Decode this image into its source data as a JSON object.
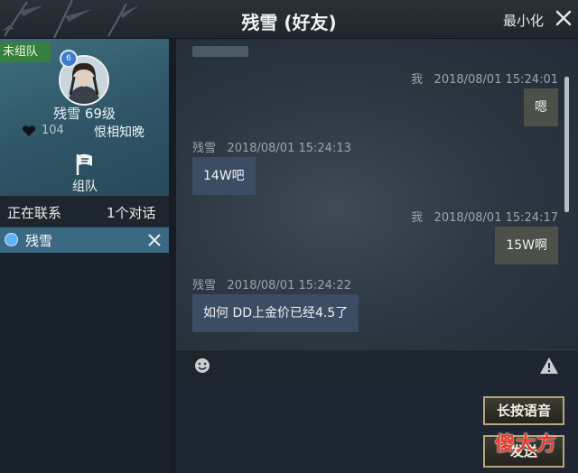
{
  "window": {
    "title": "残雪 (好友)",
    "minimize_label": "最小化",
    "close_icon": "close-icon"
  },
  "profile": {
    "team_status": "未组队",
    "name_level": "残雪  69级",
    "intimacy": "104",
    "relation": "恨相知晚",
    "team_button_label": "组队"
  },
  "contacts": {
    "header_left": "正在联系",
    "header_right": "1个对话",
    "items": [
      {
        "name": "残雪"
      }
    ]
  },
  "messages": [
    {
      "sender": "我",
      "time": "2018/08/01  15:24:01",
      "text": "嗯",
      "mine": true
    },
    {
      "sender": "残雪",
      "time": "2018/08/01  15:24:13",
      "text": "14W吧",
      "mine": false
    },
    {
      "sender": "我",
      "time": "2018/08/01  15:24:17",
      "text": "15W啊",
      "mine": true
    },
    {
      "sender": "残雪",
      "time": "2018/08/01  15:24:22",
      "text": "如何  DD上金价已经4.5了",
      "mine": false
    }
  ],
  "input": {
    "voice_button_label": "长按语音",
    "send_button_label": "发送"
  },
  "watermark": "傻大方",
  "colors": {
    "accent_blue": "#3b6883",
    "team_badge_green": "#36803e",
    "button_border_gold": "#b6a67a",
    "watermark_red": "#e53b2b"
  }
}
